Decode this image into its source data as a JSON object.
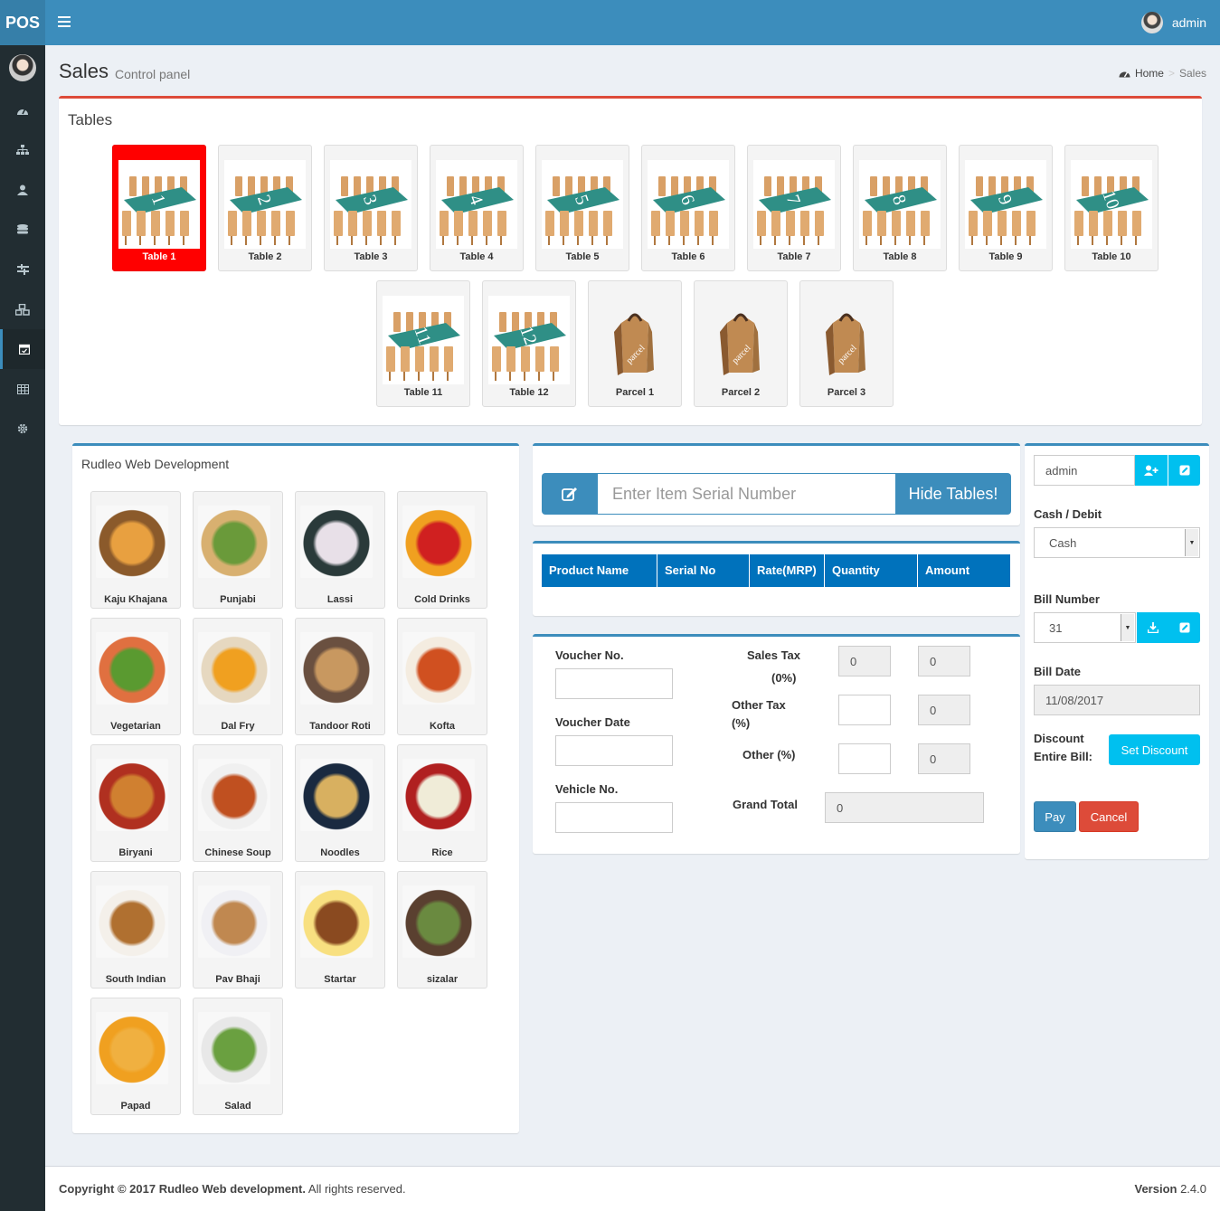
{
  "app": {
    "logo": "POS",
    "user": "admin"
  },
  "header": {
    "title": "Sales",
    "subtitle": "Control panel"
  },
  "breadcrumb": {
    "home": "Home",
    "current": "Sales"
  },
  "sidebar": {
    "items": [
      "dashboard-icon",
      "sitemap-icon",
      "user-icon",
      "database-icon",
      "sliders-icon",
      "cubes-icon",
      "calendar-icon",
      "table-icon",
      "gear-icon"
    ],
    "active_index": 6
  },
  "tables": {
    "title": "Tables",
    "items": [
      {
        "label": "Table 1",
        "num": "1",
        "active": true
      },
      {
        "label": "Table 2",
        "num": "2"
      },
      {
        "label": "Table 3",
        "num": "3"
      },
      {
        "label": "Table 4",
        "num": "4"
      },
      {
        "label": "Table 5",
        "num": "5"
      },
      {
        "label": "Table 6",
        "num": "6"
      },
      {
        "label": "Table 7",
        "num": "7"
      },
      {
        "label": "Table 8",
        "num": "8"
      },
      {
        "label": "Table 9",
        "num": "9"
      },
      {
        "label": "Table 10",
        "num": "10"
      },
      {
        "label": "Table 11",
        "num": "11"
      },
      {
        "label": "Table 12",
        "num": "12"
      },
      {
        "label": "Parcel 1",
        "num": "parcel",
        "parcel": true
      },
      {
        "label": "Parcel 2",
        "num": "parcel",
        "parcel": true
      },
      {
        "label": "Parcel 3",
        "num": "parcel",
        "parcel": true
      }
    ]
  },
  "menu": {
    "title": "Rudleo Web Development",
    "items": [
      {
        "label": "Kaju Khajana",
        "c1": "#e8a040",
        "c2": "#8b5a2b"
      },
      {
        "label": "Punjabi",
        "c1": "#6a9a3a",
        "c2": "#d8b070"
      },
      {
        "label": "Lassi",
        "c1": "#e8e0e8",
        "c2": "#2a3a3a"
      },
      {
        "label": "Cold Drinks",
        "c1": "#d02020",
        "c2": "#f0a020"
      },
      {
        "label": "Vegetarian",
        "c1": "#5a9a30",
        "c2": "#e07040"
      },
      {
        "label": "Dal Fry",
        "c1": "#f0a020",
        "c2": "#e6d8c0"
      },
      {
        "label": "Tandoor Roti",
        "c1": "#c89860",
        "c2": "#6a5040"
      },
      {
        "label": "Kofta",
        "c1": "#d05020",
        "c2": "#f4ece0"
      },
      {
        "label": "Biryani",
        "c1": "#d08030",
        "c2": "#b03020"
      },
      {
        "label": "Chinese Soup",
        "c1": "#c05020",
        "c2": "#f0f0f0"
      },
      {
        "label": "Noodles",
        "c1": "#d8b060",
        "c2": "#1a2a40"
      },
      {
        "label": "Rice",
        "c1": "#f0ecd8",
        "c2": "#b02020"
      },
      {
        "label": "South Indian",
        "c1": "#b07030",
        "c2": "#f4f0ea"
      },
      {
        "label": "Pav Bhaji",
        "c1": "#c08850",
        "c2": "#f0f0f4"
      },
      {
        "label": "Startar",
        "c1": "#8a4a20",
        "c2": "#f8e080"
      },
      {
        "label": "sizalar",
        "c1": "#6a8a40",
        "c2": "#5a4030"
      },
      {
        "label": "Papad",
        "c1": "#f0b040",
        "c2": "#f0a020"
      },
      {
        "label": "Salad",
        "c1": "#6aa040",
        "c2": "#e8e8e8"
      }
    ]
  },
  "serial": {
    "placeholder": "Enter Item Serial Number",
    "button": "Hide Tables!"
  },
  "grid": {
    "columns": [
      "Product Name",
      "Serial No",
      "Rate(MRP)",
      "Quantity",
      "Amount"
    ]
  },
  "voucher": {
    "voucher_no_label": "Voucher No.",
    "voucher_date_label": "Voucher Date",
    "vehicle_no_label": "Vehicle No.",
    "sales_tax_label": "Sales Tax",
    "sales_tax_pct": "(0%)",
    "sales_tax_rate": "0",
    "sales_tax_amount": "0",
    "other_tax_label": "Other Tax",
    "other_tax_pct": "(%)",
    "other_tax_amount": "0",
    "other_label": "Other (%)",
    "other_amount": "0",
    "grand_total_label": "Grand Total",
    "grand_total": "0"
  },
  "billing": {
    "customer": "admin",
    "payment_label": "Cash / Debit",
    "payment_value": "Cash",
    "bill_number_label": "Bill Number",
    "bill_number": "31",
    "bill_date_label": "Bill Date",
    "bill_date": "11/08/2017",
    "discount_label_1": "Discount",
    "discount_label_2": "Entire Bill:",
    "set_discount": "Set Discount",
    "pay": "Pay",
    "cancel": "Cancel"
  },
  "footer": {
    "copyright": "Copyright © 2017 Rudleo Web development.",
    "rights": "All rights reserved.",
    "version_label": "Version",
    "version": "2.4.0"
  },
  "colors": {
    "header": "#3c8dbc",
    "sidebar": "#222d32",
    "active_table": "#ff0000",
    "grid_head": "#0072bc",
    "info": "#00c0ef",
    "danger": "#dd4b39"
  }
}
